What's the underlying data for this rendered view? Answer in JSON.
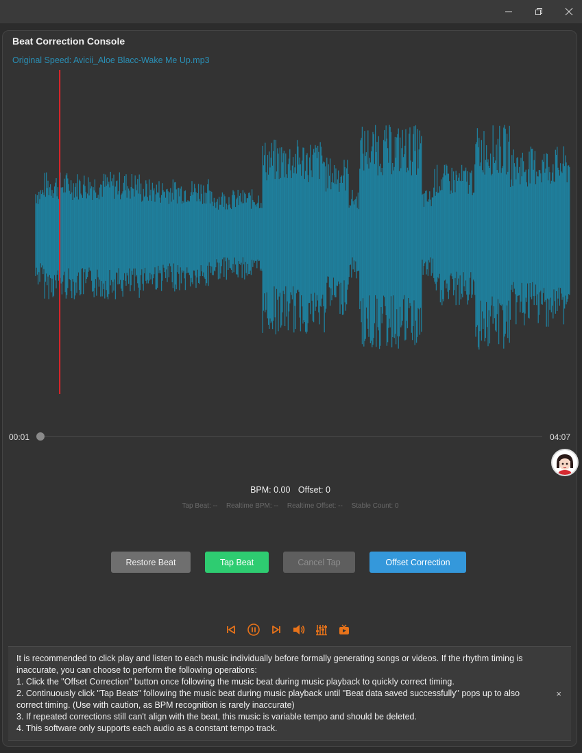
{
  "window": {
    "controls": {
      "minimize": "minimize-icon",
      "restore": "restore-icon",
      "close": "close-icon"
    }
  },
  "panel": {
    "title": "Beat Correction Console",
    "file_label": "Original Speed: Avicii_Aloe Blacc-Wake Me Up.mp3"
  },
  "waveform": {
    "color": "#1f7f9c",
    "playhead_color": "#e0252a",
    "playhead_fraction": 0.045
  },
  "timeline": {
    "current": "00:01",
    "total": "04:07",
    "progress": 0.004
  },
  "stats": {
    "bpm": "BPM: 0.00",
    "offset": "Offset: 0",
    "tap_beat": "Tap Beat: --",
    "realtime_bpm": "Realtime BPM: --",
    "realtime_offset": "Realtime Offset: --",
    "stable_count": "Stable Count: 0"
  },
  "buttons": {
    "restore": "Restore Beat",
    "tap": "Tap Beat",
    "cancel": "Cancel Tap",
    "offset": "Offset Correction"
  },
  "controls": {
    "color": "#e8731a",
    "items": [
      "prev-icon",
      "pause-icon",
      "next-icon",
      "volume-icon",
      "equalizer-icon",
      "tv-icon"
    ]
  },
  "info": {
    "lines": [
      "It is recommended to click play and listen to each music individually before formally generating songs or videos. If the rhythm timing is inaccurate, you can choose to perform the following operations:",
      "1. Click the \"Offset Correction\" button once following the music beat during music playback to quickly correct timing.",
      "2. Continuously click \"Tap Beats\" following the music beat during music playback until \"Beat data saved successfully\" pops up to also correct timing. (Use with caution, as BPM recognition is rarely inaccurate)",
      "3. If repeated corrections still can't align with the beat, this music is variable tempo and should be deleted.",
      "4. This software only supports each audio as a constant tempo track."
    ],
    "close": "×"
  }
}
